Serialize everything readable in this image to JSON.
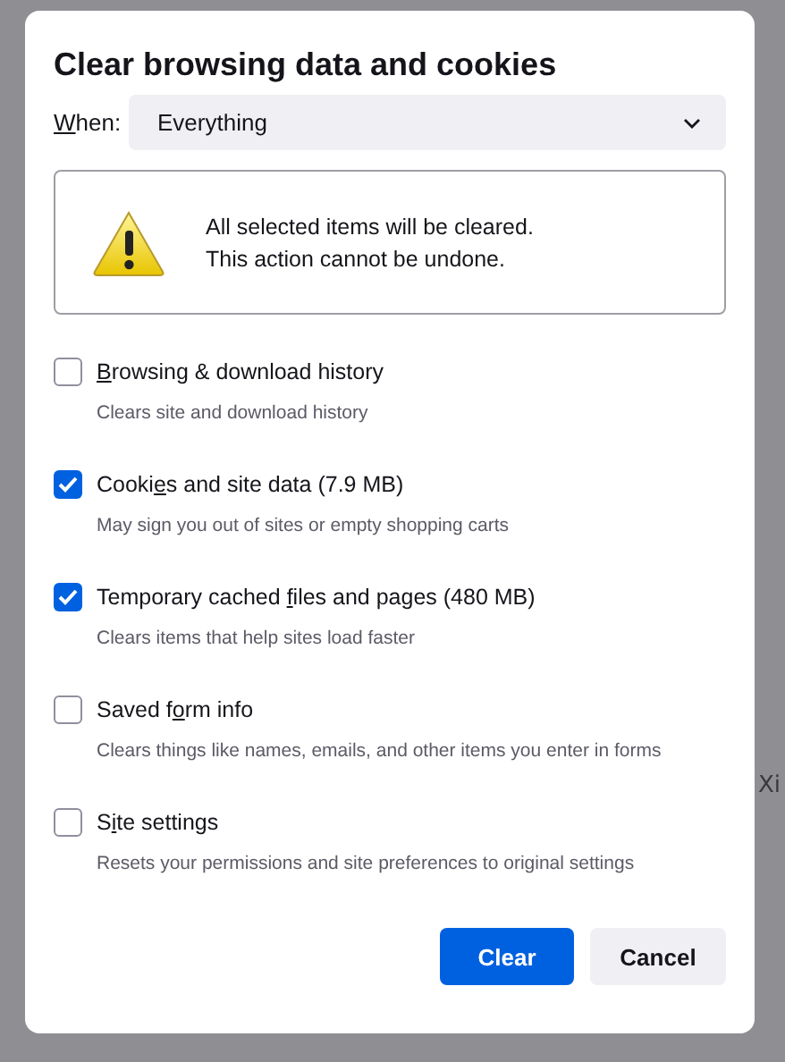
{
  "backdrop": {
    "texts": [
      "Xi"
    ]
  },
  "dialog": {
    "title": "Clear browsing data and cookies",
    "when": {
      "label": {
        "key": "W",
        "after": "hen:"
      },
      "value": "Everything"
    },
    "warning": {
      "lines": [
        "All selected items will be cleared.",
        "This action cannot be undone."
      ]
    },
    "options": [
      {
        "label": {
          "key": "B",
          "after": "rowsing & download history"
        },
        "description": "Clears site and download history",
        "checked": false
      },
      {
        "label": {
          "before": "Cooki",
          "key": "e",
          "after": "s and site data (7.9 MB)"
        },
        "description": "May sign you out of sites or empty shopping carts",
        "checked": true
      },
      {
        "label": {
          "before": "Temporary cached ",
          "key": "f",
          "after": "iles and pages (480 MB)"
        },
        "description": "Clears items that help sites load faster",
        "checked": true
      },
      {
        "label": {
          "before": "Saved f",
          "key": "o",
          "after": "rm info"
        },
        "description": "Clears things like names, emails, and other items you enter in forms",
        "checked": false
      },
      {
        "label": {
          "before": "S",
          "key": "i",
          "after": "te settings"
        },
        "description": "Resets your permissions and site preferences to original settings",
        "checked": false
      }
    ],
    "buttons": [
      {
        "label": "Clear",
        "kind": "primary"
      },
      {
        "label": "Cancel",
        "kind": "secondary"
      }
    ]
  }
}
